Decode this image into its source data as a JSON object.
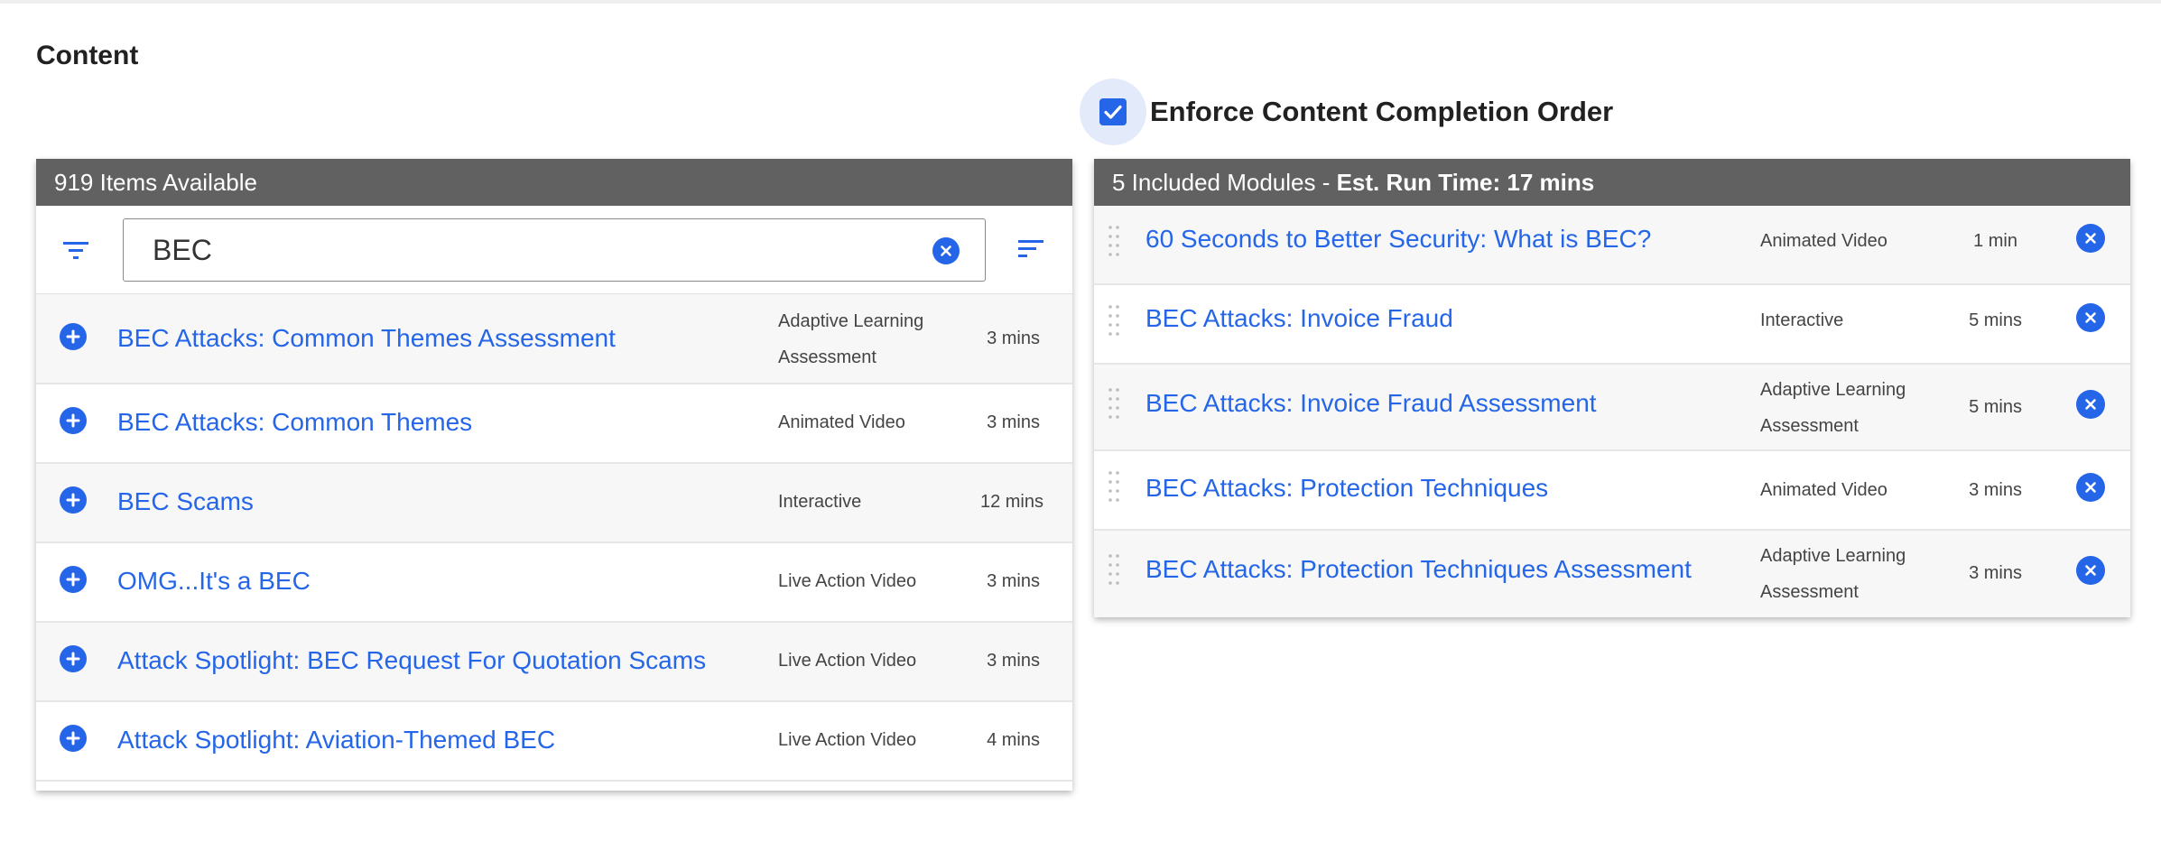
{
  "page": {
    "title": "Content",
    "enforce_label": "Enforce Content Completion Order",
    "enforce_checked": true,
    "accent_color": "#2566e8",
    "header_bg": "#616161"
  },
  "available": {
    "header": "919 Items Available",
    "search_value": "BEC",
    "icons": {
      "filter": "filter-icon",
      "clear": "clear-circle-icon",
      "sort": "sort-icon",
      "add": "add-circle-icon"
    },
    "items": [
      {
        "title": "BEC Attacks: Common Themes Assessment",
        "type_line1": "Adaptive Learning",
        "type_line2": "Assessment",
        "duration": "3 mins"
      },
      {
        "title": "BEC Attacks: Common Themes",
        "type_line1": "Animated Video",
        "type_line2": "",
        "duration": "3 mins"
      },
      {
        "title": "BEC Scams",
        "type_line1": "Interactive",
        "type_line2": "",
        "duration": "12 mins"
      },
      {
        "title": "OMG...It's a BEC",
        "type_line1": "Live Action Video",
        "type_line2": "",
        "duration": "3 mins"
      },
      {
        "title": "Attack Spotlight: BEC Request For Quotation Scams",
        "type_line1": "Live Action Video",
        "type_line2": "",
        "duration": "3 mins"
      },
      {
        "title": "Attack Spotlight: Aviation-Themed BEC",
        "type_line1": "Live Action Video",
        "type_line2": "",
        "duration": "4 mins"
      }
    ]
  },
  "included": {
    "header_prefix": "5 Included Modules - ",
    "header_runtime": "Est. Run Time: 17 mins",
    "icons": {
      "drag": "drag-handle-icon",
      "remove": "remove-circle-icon"
    },
    "items": [
      {
        "title": "60 Seconds to Better Security: What is BEC?",
        "type_line1": "Animated Video",
        "type_line2": "",
        "duration": "1 min"
      },
      {
        "title": "BEC Attacks: Invoice Fraud",
        "type_line1": "Interactive",
        "type_line2": "",
        "duration": "5 mins"
      },
      {
        "title": "BEC Attacks: Invoice Fraud Assessment",
        "type_line1": "Adaptive Learning",
        "type_line2": "Assessment",
        "duration": "5 mins"
      },
      {
        "title": "BEC Attacks: Protection Techniques",
        "type_line1": "Animated Video",
        "type_line2": "",
        "duration": "3 mins"
      },
      {
        "title": "BEC Attacks: Protection Techniques Assessment",
        "type_line1": "Adaptive Learning",
        "type_line2": "Assessment",
        "duration": "3 mins"
      }
    ]
  }
}
